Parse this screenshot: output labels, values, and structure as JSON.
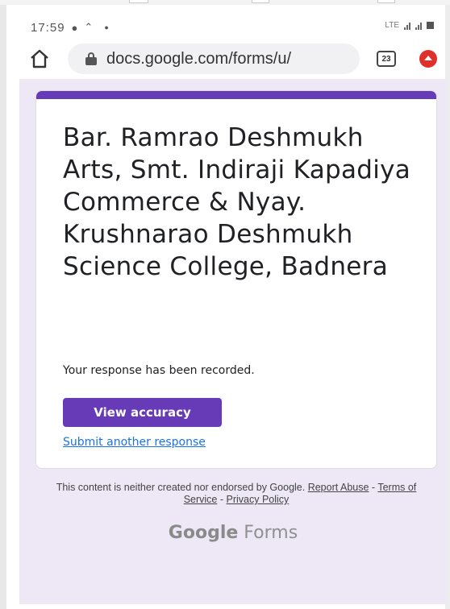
{
  "status_bar": {
    "time": "17:59",
    "icons": [
      "messenger-icon",
      "notification-icon",
      "dot-icon"
    ],
    "right_text": "LTE"
  },
  "browser": {
    "url": "docs.google.com/forms/u/",
    "tab_count": "23"
  },
  "form": {
    "title": "Bar. Ramrao Deshmukh Arts, Smt. Indiraji Kapadiya Commerce & Nyay. Krushnarao Deshmukh Science College, Badnera",
    "confirmation": "Your response has been recorded.",
    "view_button_label": "View accuracy",
    "submit_another_label": "Submit another response",
    "accent_color": "#673ab7"
  },
  "footer": {
    "disclaimer_prefix": "This content is neither created nor endorsed by Google.",
    "report_label": "Report Abuse",
    "sep1": " - ",
    "terms_label": "Terms of Service",
    "sep2": " - ",
    "privacy_label": "Privacy Policy",
    "logo_google": "Google",
    "logo_forms": "Forms"
  }
}
